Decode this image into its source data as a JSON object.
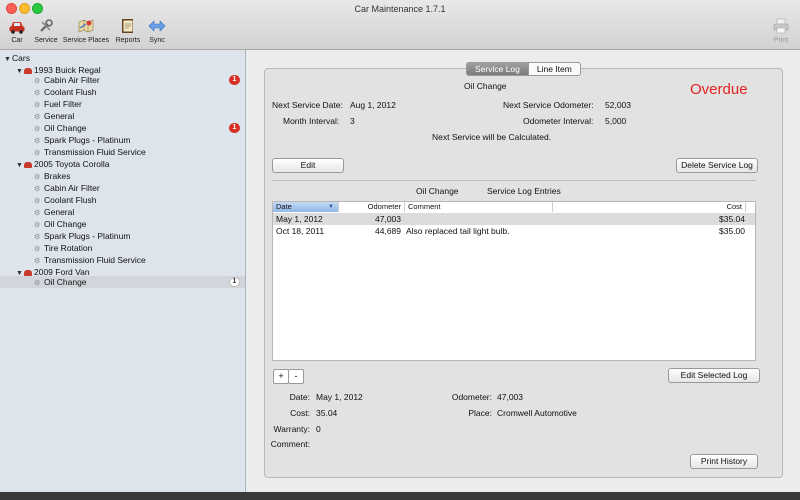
{
  "window": {
    "title": "Car Maintenance 1.7.1"
  },
  "toolbar": {
    "car": "Car",
    "service": "Service",
    "service_places": "Service Places",
    "reports": "Reports",
    "sync": "Sync",
    "print": "Print"
  },
  "sidebar": {
    "root": "Cars",
    "cars": [
      {
        "name": "1993 Buick Regal",
        "items": [
          {
            "label": "Cabin Air Filter",
            "badge": "1"
          },
          {
            "label": "Coolant Flush"
          },
          {
            "label": "Fuel Filter"
          },
          {
            "label": "General"
          },
          {
            "label": "Oil Change",
            "badge": "1"
          },
          {
            "label": "Spark Plugs - Platinum"
          },
          {
            "label": "Transmission Fluid Service"
          }
        ]
      },
      {
        "name": "2005 Toyota Corolla",
        "items": [
          {
            "label": "Brakes"
          },
          {
            "label": "Cabin Air Filter"
          },
          {
            "label": "Coolant Flush"
          },
          {
            "label": "General"
          },
          {
            "label": "Oil Change"
          },
          {
            "label": "Spark Plugs - Platinum"
          },
          {
            "label": "Tire Rotation"
          },
          {
            "label": "Transmission Fluid Service"
          }
        ]
      },
      {
        "name": "2009 Ford Van",
        "items": [
          {
            "label": "Oil Change",
            "badge": "1"
          }
        ]
      }
    ]
  },
  "tabs": {
    "service_log": "Service Log",
    "line_item": "Line Item"
  },
  "service": {
    "name": "Oil Change",
    "status": "Overdue",
    "next_service_date_label": "Next Service Date:",
    "next_service_date": "Aug 1, 2012",
    "next_service_odometer_label": "Next Service Odometer:",
    "next_service_odometer": "52,003",
    "month_interval_label": "Month Interval:",
    "month_interval": "3",
    "odometer_interval_label": "Odometer Interval:",
    "odometer_interval": "5,000",
    "note": "Next Service will be Calculated.",
    "edit_button": "Edit",
    "delete_button": "Delete Service Log"
  },
  "log": {
    "service_name": "Oil Change",
    "title": "Service Log Entries",
    "columns": {
      "date": "Date",
      "odometer": "Odometer",
      "comment": "Comment",
      "cost": "Cost"
    },
    "rows": [
      {
        "date": "May 1, 2012",
        "odometer": "47,003",
        "comment": "",
        "cost": "$35.04"
      },
      {
        "date": "Oct 18, 2011",
        "odometer": "44,689",
        "comment": "Also replaced tail light bulb.",
        "cost": "$35.00"
      }
    ],
    "add_button": "+",
    "remove_button": "-",
    "edit_selected_button": "Edit Selected Log"
  },
  "detail": {
    "date_label": "Date:",
    "date": "May 1, 2012",
    "odometer_label": "Odometer:",
    "odometer": "47,003",
    "cost_label": "Cost:",
    "cost": "35.04",
    "place_label": "Place:",
    "place": "Cromwell Automotive",
    "warranty_label": "Warranty:",
    "warranty": "0",
    "comment_label": "Comment:",
    "comment": ""
  },
  "print_history_button": "Print History"
}
